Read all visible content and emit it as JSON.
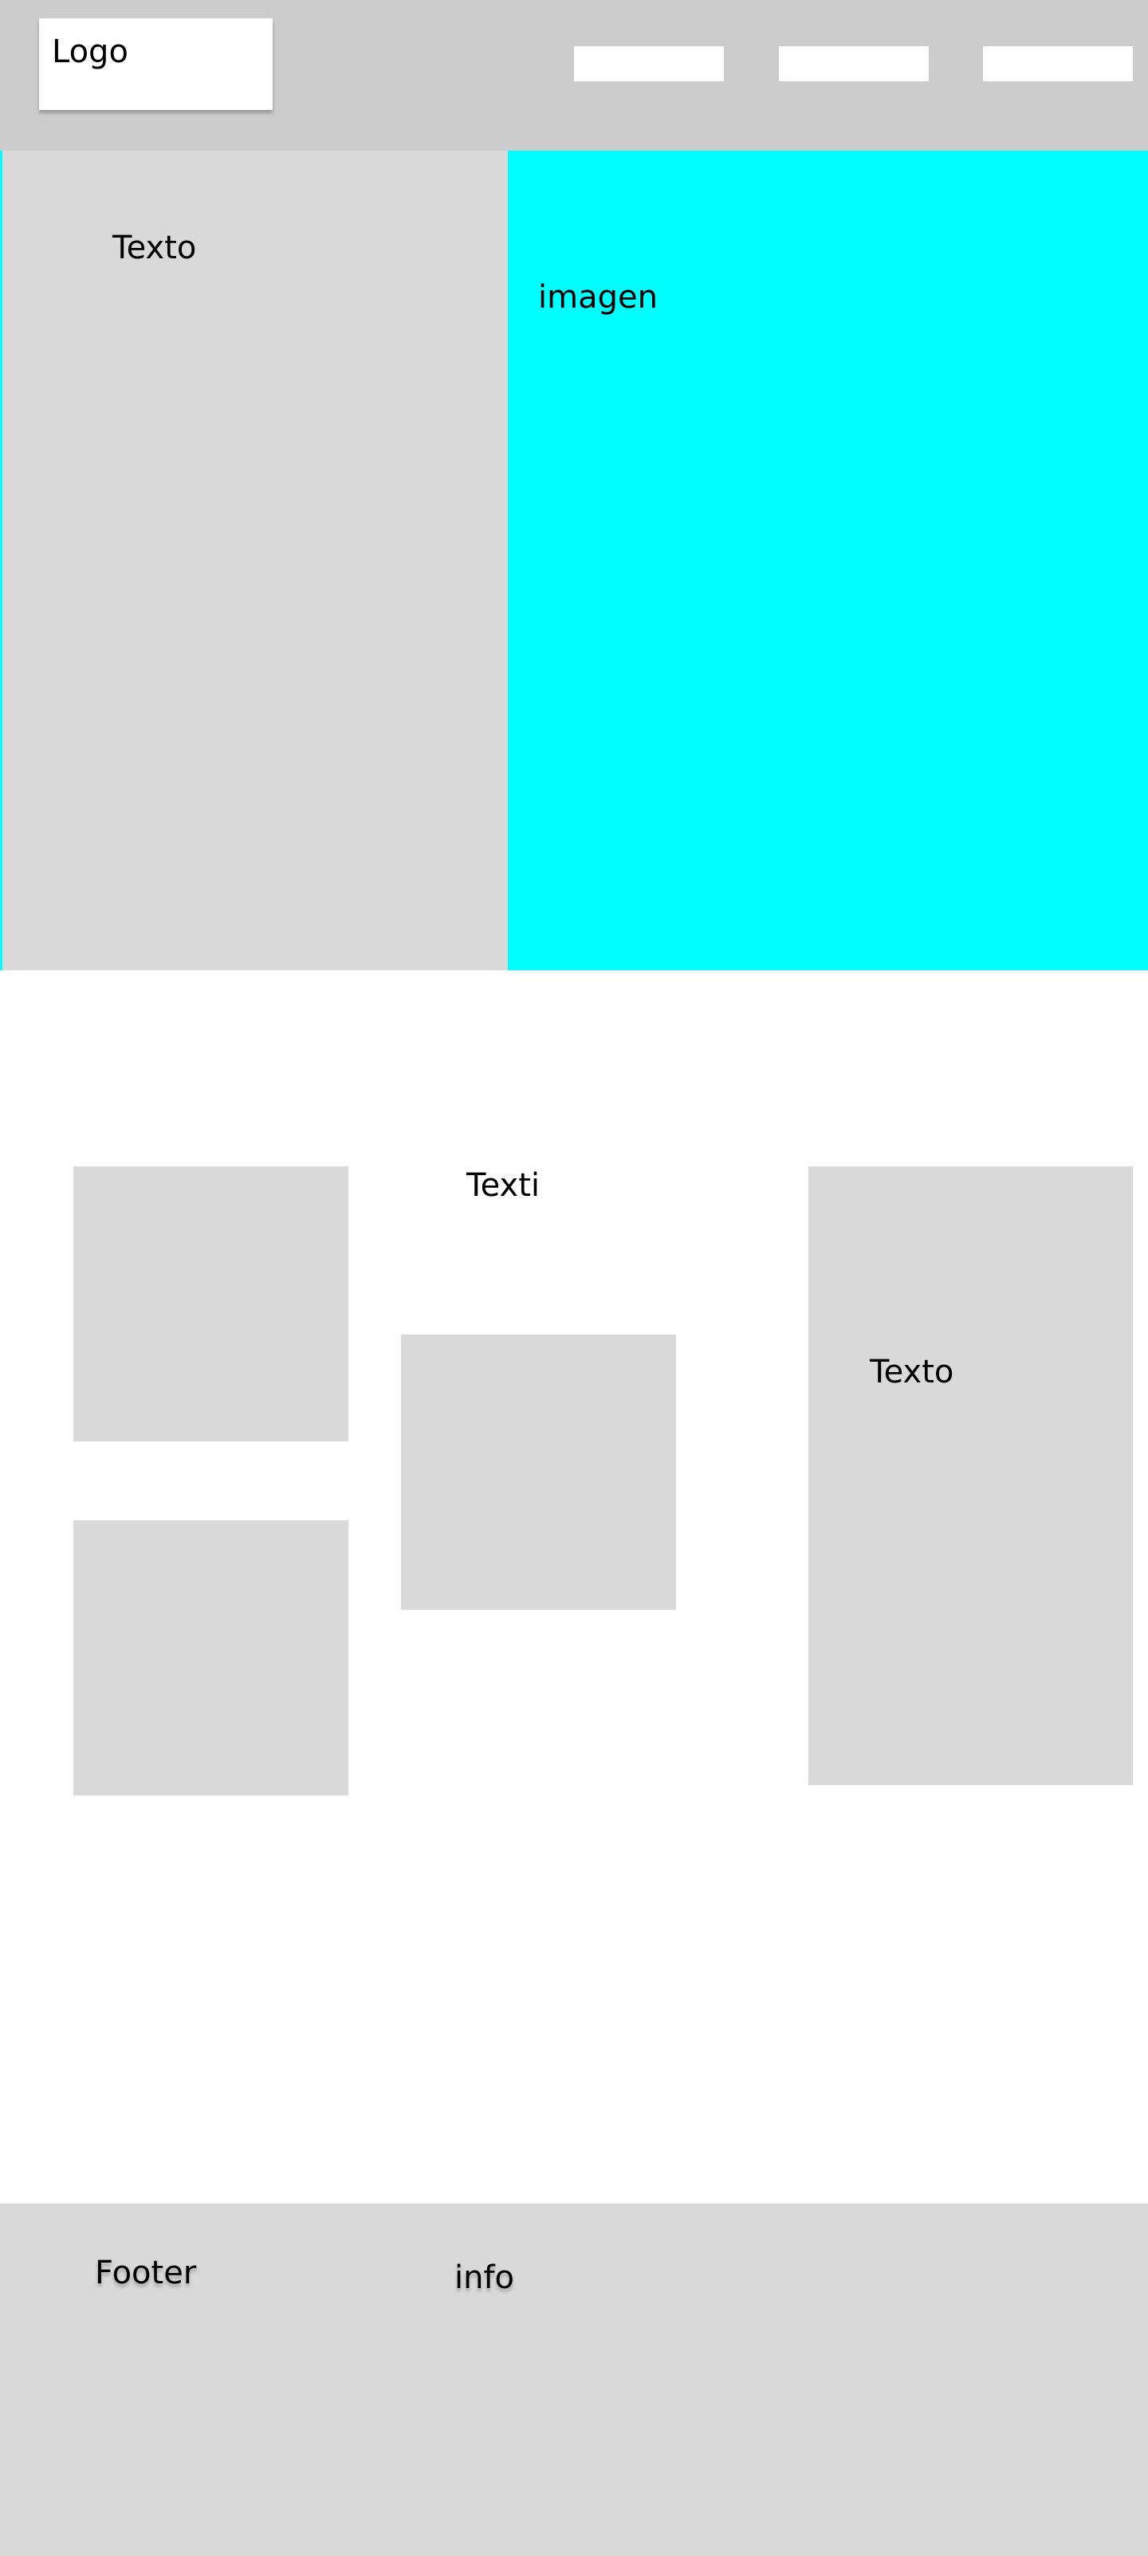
{
  "header": {
    "logo_label": "Logo",
    "nav_items": [
      "",
      "",
      ""
    ]
  },
  "hero": {
    "text": "Texto",
    "image_label": "imagen"
  },
  "content": {
    "title": "Texti",
    "card_text": "Texto"
  },
  "footer": {
    "title": "Footer",
    "info": "info"
  },
  "colors": {
    "header_bg": "#cccccc",
    "panel_gray": "#d9d9d9",
    "accent_cyan": "#00ffff",
    "white": "#ffffff",
    "text": "#000000"
  }
}
